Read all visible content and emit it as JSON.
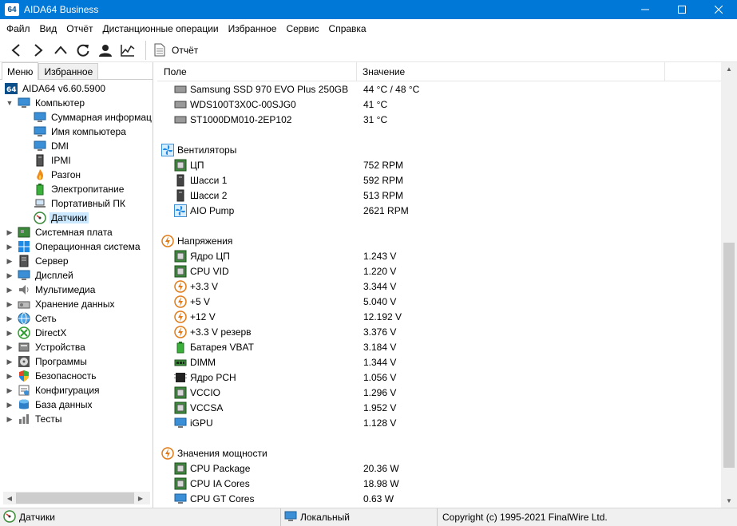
{
  "window": {
    "app_badge": "64",
    "title": "AIDA64 Business"
  },
  "menu": [
    "Файл",
    "Вид",
    "Отчёт",
    "Дистанционные операции",
    "Избранное",
    "Сервис",
    "Справка"
  ],
  "toolbar": {
    "report_label": "Отчёт"
  },
  "tabs": {
    "menu": "Меню",
    "favorites": "Избранное"
  },
  "tree": {
    "root": "AIDA64 v6.60.5900",
    "computer": "Компьютер",
    "computer_children": [
      "Суммарная информация",
      "Имя компьютера",
      "DMI",
      "IPMI",
      "Разгон",
      "Электропитание",
      "Портативный ПК",
      "Датчики"
    ],
    "sections": [
      "Системная плата",
      "Операционная система",
      "Сервер",
      "Дисплей",
      "Мультимедиа",
      "Хранение данных",
      "Сеть",
      "DirectX",
      "Устройства",
      "Программы",
      "Безопасность",
      "Конфигурация",
      "База данных",
      "Тесты"
    ]
  },
  "columns": {
    "field": "Поле",
    "value": "Значение"
  },
  "temps": [
    {
      "name": "Samsung SSD 970 EVO Plus 250GB",
      "value": "44 °C / 48 °C"
    },
    {
      "name": "WDS100T3X0C-00SJG0",
      "value": "41 °C"
    },
    {
      "name": "ST1000DM010-2EP102",
      "value": "31 °C"
    }
  ],
  "fans": {
    "title": "Вентиляторы",
    "items": [
      {
        "name": "ЦП",
        "value": "752 RPM"
      },
      {
        "name": "Шасси 1",
        "value": "592 RPM"
      },
      {
        "name": "Шасси 2",
        "value": "513 RPM"
      },
      {
        "name": "AIO Pump",
        "value": "2621 RPM"
      }
    ]
  },
  "voltages": {
    "title": "Напряжения",
    "items": [
      {
        "name": "Ядро ЦП",
        "value": "1.243 V"
      },
      {
        "name": "CPU VID",
        "value": "1.220 V"
      },
      {
        "name": "+3.3 V",
        "value": "3.344 V"
      },
      {
        "name": "+5 V",
        "value": "5.040 V"
      },
      {
        "name": "+12 V",
        "value": "12.192 V"
      },
      {
        "name": "+3.3 V резерв",
        "value": "3.376 V"
      },
      {
        "name": "Батарея VBAT",
        "value": "3.184 V"
      },
      {
        "name": "DIMM",
        "value": "1.344 V"
      },
      {
        "name": "Ядро PCH",
        "value": "1.056 V"
      },
      {
        "name": "VCCIO",
        "value": "1.296 V"
      },
      {
        "name": "VCCSA",
        "value": "1.952 V"
      },
      {
        "name": "iGPU",
        "value": "1.128 V"
      }
    ]
  },
  "power": {
    "title": "Значения мощности",
    "items": [
      {
        "name": "CPU Package",
        "value": "20.36 W"
      },
      {
        "name": "CPU IA Cores",
        "value": "18.98 W"
      },
      {
        "name": "CPU GT Cores",
        "value": "0.63 W"
      }
    ]
  },
  "status": {
    "section": "Датчики",
    "mode": "Локальный",
    "copyright": "Copyright (c) 1995-2021 FinalWire Ltd."
  },
  "colors": {
    "titlebar": "#0078d7",
    "selection": "#cce8ff"
  }
}
